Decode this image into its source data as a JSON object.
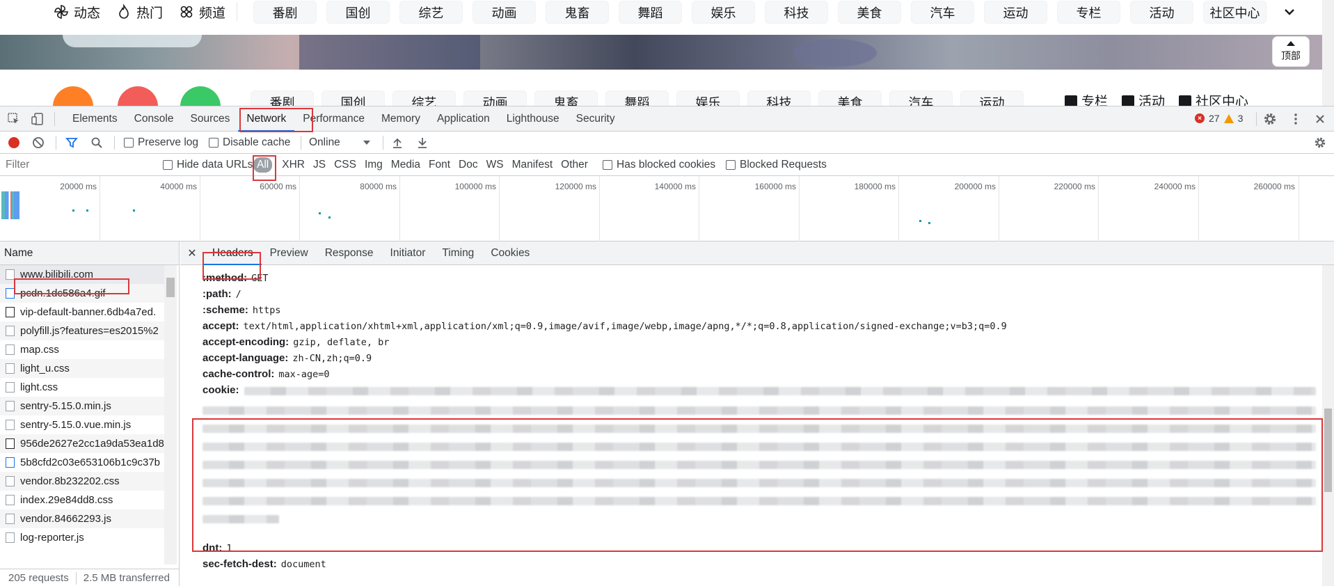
{
  "page": {
    "nav_left": [
      {
        "icon": "pinwheel-icon",
        "label": "动态"
      },
      {
        "icon": "flame-icon",
        "label": "热门"
      },
      {
        "icon": "channels-icon",
        "label": "频道"
      }
    ],
    "categories_row1": [
      "番剧",
      "国创",
      "综艺",
      "动画",
      "鬼畜",
      "舞蹈",
      "娱乐",
      "科技",
      "美食",
      "汽车",
      "运动",
      "专栏",
      "活动",
      "社区中心"
    ],
    "categories_row2": [
      "番剧",
      "国创",
      "综艺",
      "动画",
      "鬼畜",
      "舞蹈",
      "娱乐",
      "科技",
      "美食",
      "汽车",
      "运动"
    ],
    "right_links": [
      {
        "icon": "article-icon",
        "label": "专栏"
      },
      {
        "icon": "flag-icon",
        "label": "活动"
      },
      {
        "icon": "community-icon",
        "label": "社区中心"
      }
    ],
    "top_button": "顶部",
    "circle_colors": [
      "#ff7f24",
      "#f25d59",
      "#3ac966"
    ]
  },
  "devtools": {
    "tabs": [
      "Elements",
      "Console",
      "Sources",
      "Network",
      "Performance",
      "Memory",
      "Application",
      "Lighthouse",
      "Security"
    ],
    "active_tab": "Network",
    "error_count": "27",
    "warning_count": "3",
    "toolbar": {
      "preserve_log": "Preserve log",
      "disable_cache": "Disable cache",
      "throttle": "Online"
    },
    "filter": {
      "placeholder": "Filter",
      "hide_data_urls": "Hide data URLs",
      "types": [
        "All",
        "XHR",
        "JS",
        "CSS",
        "Img",
        "Media",
        "Font",
        "Doc",
        "WS",
        "Manifest",
        "Other"
      ],
      "has_blocked_cookies": "Has blocked cookies",
      "blocked_requests": "Blocked Requests"
    },
    "overview_ticks": [
      "20000 ms",
      "40000 ms",
      "60000 ms",
      "80000 ms",
      "100000 ms",
      "120000 ms",
      "140000 ms",
      "160000 ms",
      "180000 ms",
      "200000 ms",
      "220000 ms",
      "240000 ms",
      "260000 ms"
    ],
    "name_header": "Name",
    "requests": [
      "www.bilibili.com",
      "pcdn.1dc586a4.gif",
      "vip-default-banner.6db4a7ed.",
      "polyfill.js?features=es2015%2",
      "map.css",
      "light_u.css",
      "light.css",
      "sentry-5.15.0.min.js",
      "sentry-5.15.0.vue.min.js",
      "956de2627e2cc1a9da53ea1d8",
      "5b8cfd2c03e653106b1c9c37b",
      "vendor.8b232202.css",
      "index.29e84dd8.css",
      "vendor.84662293.js",
      "log-reporter.js"
    ],
    "status": {
      "requests": "205 requests",
      "transferred": "2.5 MB transferred"
    },
    "detail_tabs": [
      "Headers",
      "Preview",
      "Response",
      "Initiator",
      "Timing",
      "Cookies"
    ],
    "headers": [
      {
        "key": ":method:",
        "value": "GET"
      },
      {
        "key": ":path:",
        "value": "/"
      },
      {
        "key": ":scheme:",
        "value": "https"
      },
      {
        "key": "accept:",
        "value": "text/html,application/xhtml+xml,application/xml;q=0.9,image/avif,image/webp,image/apng,*/*;q=0.8,application/signed-exchange;v=b3;q=0.9"
      },
      {
        "key": "accept-encoding:",
        "value": "gzip, deflate, br"
      },
      {
        "key": "accept-language:",
        "value": "zh-CN,zh;q=0.9"
      },
      {
        "key": "cache-control:",
        "value": "max-age=0"
      },
      {
        "key": "cookie:",
        "value": ""
      },
      {
        "key": "dnt:",
        "value": "1"
      },
      {
        "key": "sec-fetch-dest:",
        "value": "document"
      }
    ],
    "accent_color": "#1a73e8",
    "annotation_color": "#d9373c"
  }
}
